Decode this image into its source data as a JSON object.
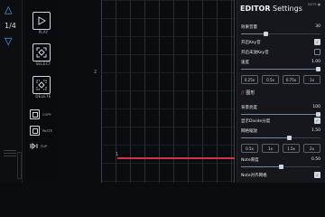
{
  "rail": {
    "counter": "1/4"
  },
  "tools": {
    "play": "PLAY",
    "select": "SELECT",
    "delete": "DELETE",
    "copy": "COPY",
    "paste": "PASTE",
    "flip": "FLIP",
    "vertical": "EDITOR"
  },
  "grid": {
    "beat_marker": "2",
    "bottom_marker": "1"
  },
  "panel": {
    "title_bold": "EDITOR",
    "title_rest": " Settings",
    "badge": "NOTE ●",
    "volume": {
      "label": "效果音量",
      "value": "30",
      "level": 0.3
    },
    "keysound": {
      "label": "开启Key音",
      "checked": true
    },
    "unplaced_keysound": {
      "label": "开启未放Key音",
      "checked": false
    },
    "speed": {
      "label": "速度",
      "value": "1.00",
      "level": 1.0
    },
    "speed_presets": [
      "0.25x",
      "0.5x",
      "0.75x",
      "1x"
    ],
    "section": "图形",
    "bg_brightness": {
      "label": "背景亮度",
      "value": "100",
      "level": 1.0
    },
    "divide_lines": {
      "label": "显示Divide分度",
      "checked": true
    },
    "grid_scale": {
      "label": "网格缩放",
      "value": "1.50",
      "level": 0.6
    },
    "scale_presets": [
      "0.5x",
      "1x",
      "1.5x",
      "2x"
    ],
    "note_thickness": {
      "label": "Note厚度",
      "value": "0.50",
      "level": 0.5
    },
    "note_snap": {
      "label": "Note对齐网格",
      "checked": true
    }
  }
}
